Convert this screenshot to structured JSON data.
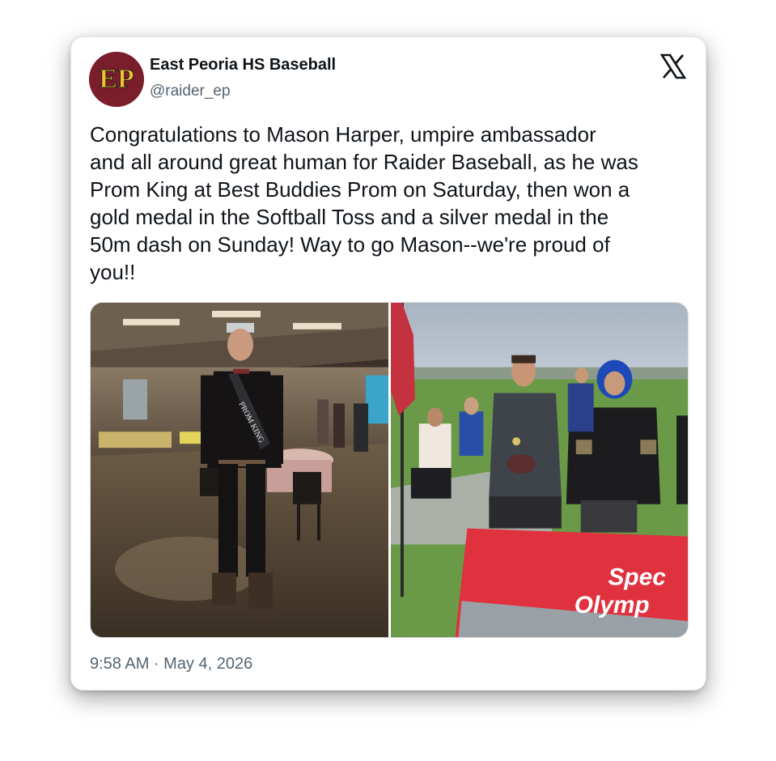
{
  "author": {
    "avatar_initials": "EP",
    "display_name": "East Peoria HS Baseball",
    "handle": "@raider_ep"
  },
  "tweet": {
    "text": "Congratulations to Mason Harper, umpire ambassador\nand all around great human for Raider Baseball, as he was\nProm King at Best Buddies Prom on Saturday, then won a\ngold medal in the Softball Toss and a silver medal in the\n50m dash on Sunday! Way to go Mason--we're proud of\nyou!!",
    "timestamp": "9:58 AM · May 4, 2026"
  },
  "media": {
    "photo_left": {
      "sash_text": "PROM KING"
    },
    "photo_right": {
      "banner_text_line1": "Spec",
      "banner_text_line2": "Olymp"
    }
  },
  "icons": {
    "brand": "x-logo-icon"
  },
  "colors": {
    "avatar_bg": "#7b1e2b",
    "avatar_letters": "#f2c230",
    "text_primary": "#0f1419",
    "text_secondary": "#536471",
    "banner_red": "#e0313f"
  }
}
